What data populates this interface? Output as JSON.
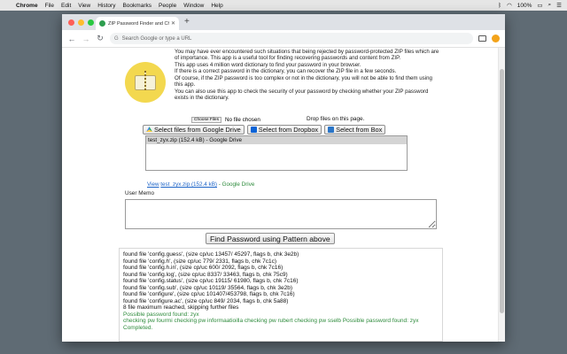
{
  "menubar": {
    "items": [
      "Chrome",
      "File",
      "Edit",
      "View",
      "History",
      "Bookmarks",
      "People",
      "Window",
      "Help"
    ],
    "battery": "100%",
    "status_icons": [
      "bluetooth-icon",
      "wifi-icon",
      "battery-icon",
      "search-icon",
      "menu-icon"
    ]
  },
  "browser": {
    "tab_title": "ZIP Password Finder and Chec",
    "omnibox_placeholder": "Search Google or type a URL"
  },
  "app": {
    "description": [
      "You may have ever encountered such situations that being rejected by password-protected ZIP files which are of importance. This app is a useful tool for finding recovering passwords and content from ZIP.",
      "This app uses 4 million word dictionary to find your password in your browser.",
      "If there is a correct password in the dictionary, you can recover the ZIP file in a few seconds.",
      "Of course, if the ZIP password is too complex or not in the dictionary, you will not be able to find them using this app.",
      "You can also use this app to check the security of your password by checking whether your ZIP password exists in the dictionary."
    ],
    "choose_files_label": "Choose Files",
    "no_file_chosen": "No file chosen",
    "drop_label": "Drop files on this page.",
    "buttons": {
      "google_drive": "Select files from Google Drive",
      "dropbox": "Select from Dropbox",
      "box": "Select from Box"
    },
    "file_list": [
      "test_zyx.zip (152.4 kB) - Google Drive"
    ],
    "view_link": "View",
    "view_file": "test_zyx.zip (152.4 kB)",
    "view_source": "- Google Drive",
    "memo_label": "User Memo",
    "find_button": "Find Password using Pattern above",
    "log": [
      {
        "text": "found file 'config.guess', (size cp/uc 13457/ 45297, flags b, chk 3e2b)",
        "color": "#111111"
      },
      {
        "text": "found file 'config.h', (size cp/uc 779/ 2331, flags b, chk 7c1c)",
        "color": "#111111"
      },
      {
        "text": "found file 'config.h.in', (size cp/uc 600/ 2092, flags b, chk 7c16)",
        "color": "#111111"
      },
      {
        "text": "found file 'config.log', (size cp/uc 8337/ 33463, flags b, chk 75c9)",
        "color": "#111111"
      },
      {
        "text": "found file 'config.status', (size cp/uc 19115/ 61980, flags b, chk 7c16)",
        "color": "#111111"
      },
      {
        "text": "found file 'config.sub', (size cp/uc 10119/ 35564, flags b, chk 3e2b)",
        "color": "#111111"
      },
      {
        "text": "found file 'configure', (size cp/uc 101407/453798, flags b, chk 7c16)",
        "color": "#111111"
      },
      {
        "text": "found file 'configure.ac', (size cp/uc 849/ 2034, flags b, chk 5a88)",
        "color": "#111111"
      },
      {
        "text": "8 file maximum reached, skipping further files",
        "color": "#111111"
      },
      {
        "text": "Possible password found: zyx",
        "color": "#2e8b3c"
      },
      {
        "text": "checking pw fourmi checking pw informaatioilla checking pw rubert checking pw sselb Possible password found: zyx",
        "color": "#2e8b3c"
      },
      {
        "text": "Completed.",
        "color": "#2e8b3c"
      }
    ]
  }
}
